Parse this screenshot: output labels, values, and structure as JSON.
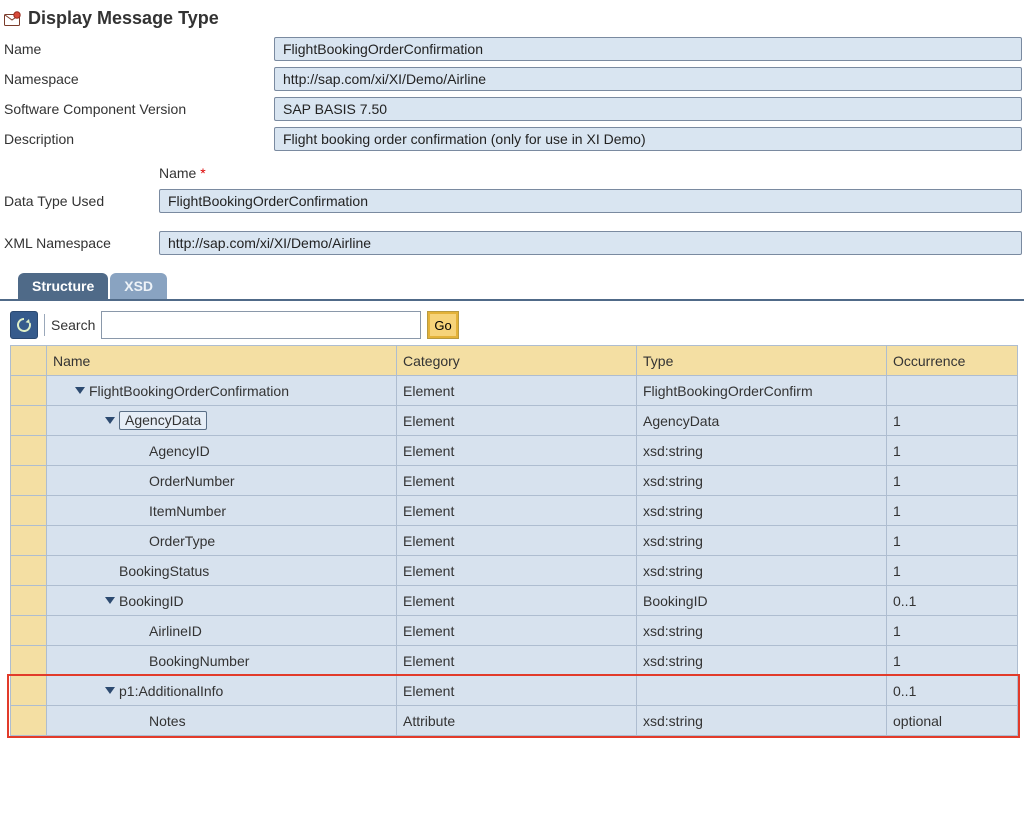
{
  "header": {
    "title": "Display Message Type"
  },
  "form": {
    "name_label": "Name",
    "name_value": "FlightBookingOrderConfirmation",
    "ns_label": "Namespace",
    "ns_value": "http://sap.com/xi/XI/Demo/Airline",
    "scv_label": "Software Component Version",
    "scv_value": "SAP BASIS 7.50",
    "desc_label": "Description",
    "desc_value": "Flight booking order confirmation (only for use in XI Demo)"
  },
  "sub": {
    "name_label": "Name",
    "req_mark": "*",
    "dtu_label": "Data Type Used",
    "dtu_value": "FlightBookingOrderConfirmation",
    "xmlns_label": "XML Namespace",
    "xmlns_value": "http://sap.com/xi/XI/Demo/Airline"
  },
  "tabs": {
    "structure": "Structure",
    "xsd": "XSD"
  },
  "toolbar": {
    "search_label": "Search",
    "go_label": "Go"
  },
  "columns": {
    "name": "Name",
    "category": "Category",
    "type": "Type",
    "occurrence": "Occurrence"
  },
  "rows": [
    {
      "indent": 0,
      "toggle": true,
      "name": "FlightBookingOrderConfirmation",
      "category": "Element",
      "type": "FlightBookingOrderConfirm",
      "occ": ""
    },
    {
      "indent": 1,
      "toggle": true,
      "name": "AgencyData",
      "selected": true,
      "category": "Element",
      "type": "AgencyData",
      "occ": "1"
    },
    {
      "indent": 2,
      "toggle": false,
      "name": "AgencyID",
      "category": "Element",
      "type": "xsd:string",
      "occ": "1"
    },
    {
      "indent": 2,
      "toggle": false,
      "name": "OrderNumber",
      "category": "Element",
      "type": "xsd:string",
      "occ": "1"
    },
    {
      "indent": 2,
      "toggle": false,
      "name": "ItemNumber",
      "category": "Element",
      "type": "xsd:string",
      "occ": "1"
    },
    {
      "indent": 2,
      "toggle": false,
      "name": "OrderType",
      "category": "Element",
      "type": "xsd:string",
      "occ": "1"
    },
    {
      "indent": 1,
      "toggle": false,
      "name": "BookingStatus",
      "category": "Element",
      "type": "xsd:string",
      "occ": "1"
    },
    {
      "indent": 1,
      "toggle": true,
      "name": "BookingID",
      "category": "Element",
      "type": "BookingID",
      "occ": "0..1"
    },
    {
      "indent": 2,
      "toggle": false,
      "name": "AirlineID",
      "category": "Element",
      "type": "xsd:string",
      "occ": "1"
    },
    {
      "indent": 2,
      "toggle": false,
      "name": "BookingNumber",
      "category": "Element",
      "type": "xsd:string",
      "occ": "1"
    },
    {
      "indent": 1,
      "toggle": true,
      "name": "p1:AdditionalInfo",
      "category": "Element",
      "type": "",
      "occ": "0..1"
    },
    {
      "indent": 2,
      "toggle": false,
      "name": "Notes",
      "category": "Attribute",
      "type": "xsd:string",
      "occ": "optional"
    }
  ]
}
